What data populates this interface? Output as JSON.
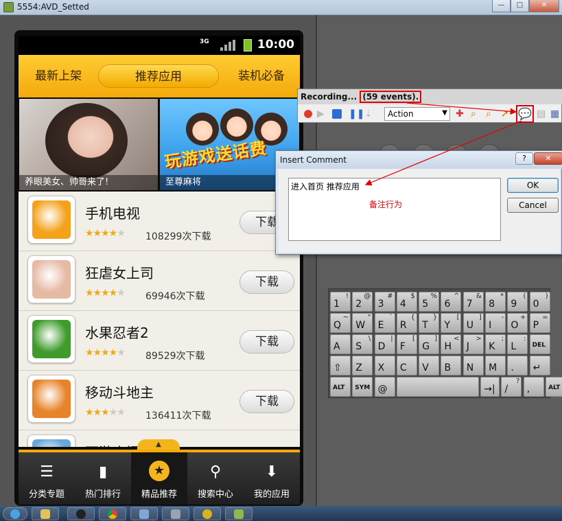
{
  "window": {
    "title": "5554:AVD_Setted",
    "controls": {
      "minimize": "—",
      "maximize": "□",
      "close": "✕"
    }
  },
  "phone": {
    "status": {
      "network": "3G",
      "time": "10:00"
    },
    "top_tabs": [
      {
        "label": "最新上架",
        "active": false
      },
      {
        "label": "推荐应用",
        "active": true
      },
      {
        "label": "装机必备",
        "active": false
      }
    ],
    "banners": [
      {
        "caption": "养眼美女、帅哥来了!"
      },
      {
        "title": "玩游戏送话费",
        "caption": "至尊麻将"
      }
    ],
    "apps": [
      {
        "name": "手机电视",
        "rating": 4,
        "downloads": "108299次下载",
        "button": "下载",
        "color": "#f4a21a"
      },
      {
        "name": "狂虐女上司",
        "rating": 3.5,
        "downloads": "69946次下载",
        "button": "下载",
        "color": "#e6b9a3"
      },
      {
        "name": "水果忍者2",
        "rating": 4,
        "downloads": "89529次下载",
        "button": "下载",
        "color": "#3f9b2c"
      },
      {
        "name": "移动斗地主",
        "rating": 3,
        "downloads": "136411次下载",
        "button": "下载",
        "color": "#e7832a"
      },
      {
        "name": "西游小闹天下",
        "rating": 0,
        "downloads": "",
        "button": "",
        "color": "#6aa6d8"
      }
    ],
    "bottom_nav": [
      {
        "label": "分类专题",
        "icon": "list-icon",
        "glyph": "☰",
        "active": false
      },
      {
        "label": "热门排行",
        "icon": "bar-chart-icon",
        "glyph": "▮",
        "active": false
      },
      {
        "label": "精品推荐",
        "icon": "star-icon",
        "glyph": "★",
        "active": true
      },
      {
        "label": "搜索中心",
        "icon": "search-icon",
        "glyph": "⚲",
        "active": false
      },
      {
        "label": "我的应用",
        "icon": "download-icon",
        "glyph": "⬇",
        "active": false
      }
    ]
  },
  "recorder": {
    "status_prefix": "Recording... ",
    "events": "(59 events).",
    "action_select": "Action"
  },
  "dialog": {
    "title": "Insert Comment",
    "help": "?",
    "close": "✕",
    "text": "进入首页 推荐应用",
    "ok": "OK",
    "cancel": "Cancel"
  },
  "annotation": "备注行为",
  "keyboard": {
    "rows": [
      [
        [
          "1",
          "!"
        ],
        [
          "2",
          "@"
        ],
        [
          "3",
          "#"
        ],
        [
          "4",
          "$"
        ],
        [
          "5",
          "%"
        ],
        [
          "6",
          "^"
        ],
        [
          "7",
          "&"
        ],
        [
          "8",
          "*"
        ],
        [
          "9",
          "("
        ],
        [
          "0",
          ")"
        ]
      ],
      [
        [
          "Q",
          "~"
        ],
        [
          "W",
          "\""
        ],
        [
          "E",
          "`"
        ],
        [
          "R",
          "{"
        ],
        [
          "T",
          "}"
        ],
        [
          "Y",
          "["
        ],
        [
          "U",
          "]"
        ],
        [
          "I",
          "-"
        ],
        [
          "O",
          "+"
        ],
        [
          "P",
          "="
        ]
      ],
      [
        [
          "A",
          ""
        ],
        [
          "S",
          "\\"
        ],
        [
          "D",
          "|"
        ],
        [
          "F",
          "["
        ],
        [
          "G",
          "]"
        ],
        [
          "H",
          "<"
        ],
        [
          "J",
          ">"
        ],
        [
          "K",
          ";"
        ],
        [
          "L",
          ":"
        ],
        [
          "DEL",
          ""
        ]
      ],
      [
        [
          "⇧",
          ""
        ],
        [
          "Z",
          ""
        ],
        [
          "X",
          ""
        ],
        [
          "C",
          ""
        ],
        [
          "V",
          ""
        ],
        [
          "B",
          ""
        ],
        [
          "N",
          ""
        ],
        [
          "M",
          ""
        ],
        [
          ".",
          ""
        ],
        [
          "↵",
          ""
        ]
      ],
      [
        [
          "ALT",
          ""
        ],
        [
          "SYM",
          ""
        ],
        [
          "@",
          ""
        ],
        [
          "",
          ""
        ],
        [
          "→|",
          ""
        ],
        [
          "/",
          "?"
        ],
        [
          ",",
          ""
        ],
        [
          "ALT",
          ""
        ]
      ]
    ]
  }
}
